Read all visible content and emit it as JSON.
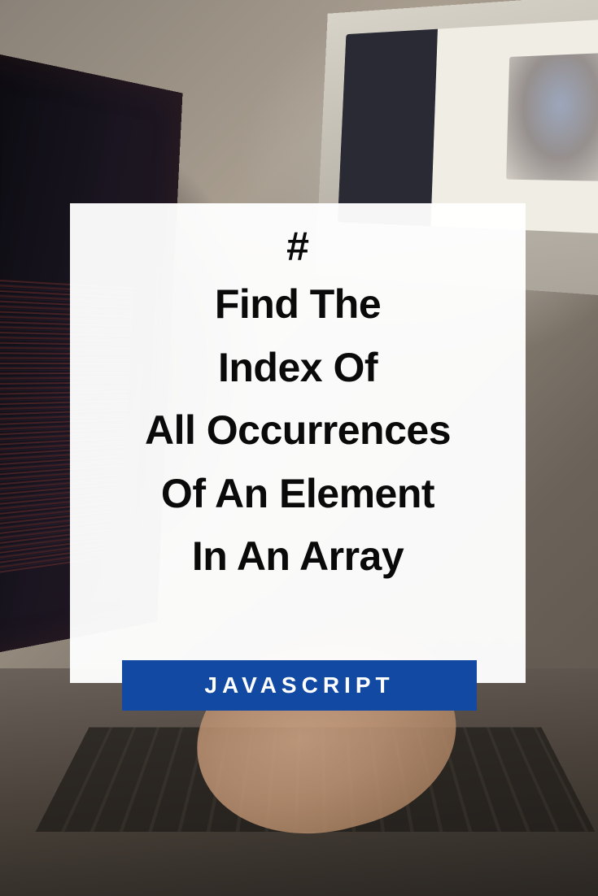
{
  "card": {
    "hash_symbol": "#",
    "title_line1": "Find The",
    "title_line2": "Index Of",
    "title_line3": "All Occurrences",
    "title_line4": "Of An Element",
    "title_line5": "In An Array"
  },
  "badge": {
    "label": "JAVASCRIPT"
  },
  "colors": {
    "badge_bg": "#1149a3",
    "card_bg": "#ffffff",
    "text": "#0a0a0a"
  }
}
